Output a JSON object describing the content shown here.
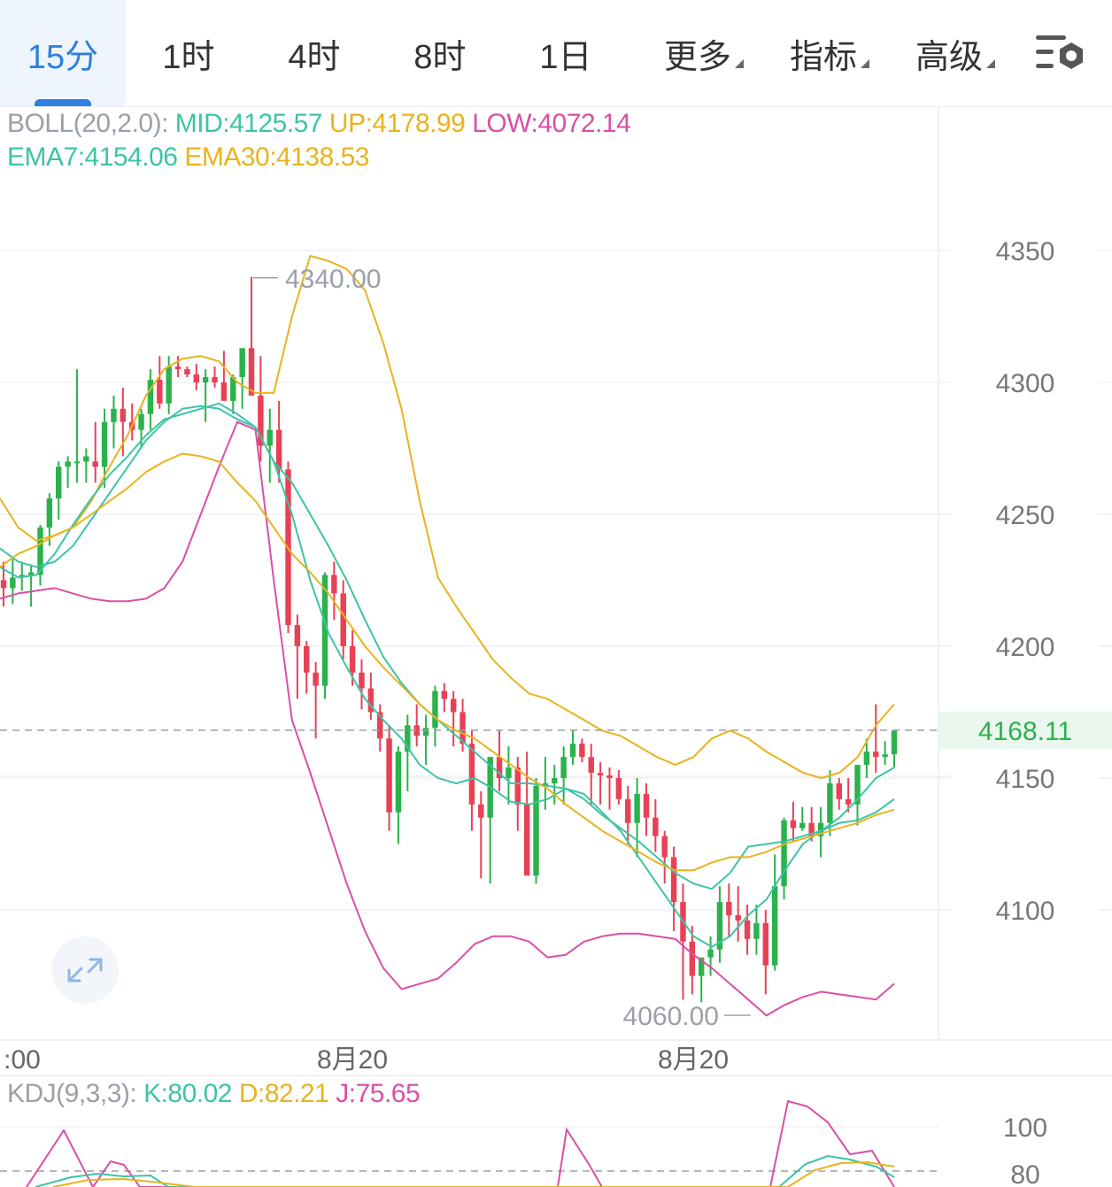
{
  "tabs": [
    {
      "label": "15分",
      "active": true
    },
    {
      "label": "1时"
    },
    {
      "label": "4时"
    },
    {
      "label": "8时"
    },
    {
      "label": "1日"
    },
    {
      "label": "更多",
      "dropdown": true
    },
    {
      "label": "指标",
      "dropdown": true
    },
    {
      "label": "高级",
      "dropdown": true
    }
  ],
  "icons": {
    "settings": "candlestick-settings-icon",
    "expand": "expand-arrows-icon"
  },
  "boll": {
    "prefix": "BOLL(20,2.0):",
    "mid": "MID:4125.57",
    "up": "UP:4178.99",
    "low": "LOW:4072.14"
  },
  "ema": {
    "ema7": "EMA7:4154.06",
    "ema30": "EMA30:4138.53"
  },
  "kdj": {
    "prefix": "KDJ(9,3,3):",
    "k": "K:80.02",
    "d": "D:82.21",
    "j": "J:75.65"
  },
  "colors": {
    "up": "#2bb24c",
    "down": "#e84155",
    "mid": "#3cc4a6",
    "upper": "#e8b31d",
    "lower": "#d94fa7",
    "ema7": "#3cc4a6",
    "ema30": "#e8b31d",
    "k": "#3cc4a6",
    "d": "#e8b31d",
    "j": "#d94fa7",
    "gray": "#9aa0a8",
    "current": "#2bb24c"
  },
  "chart_data": {
    "type": "candlestick",
    "ylim": [
      4060,
      4350
    ],
    "y_ticks": [
      "4350",
      "4300",
      "4250",
      "4200",
      "4150",
      "4100"
    ],
    "x_labels": [
      ":00",
      "8月20",
      "8月20"
    ],
    "current_price": "4168.11",
    "high_marker": "4340.00",
    "low_marker": "4060.00",
    "candles": [
      [
        4225,
        4232,
        4215,
        4222
      ],
      [
        4222,
        4234,
        4216,
        4226
      ],
      [
        4226,
        4232,
        4221,
        4227
      ],
      [
        4227,
        4231,
        4215,
        4228
      ],
      [
        4227,
        4246,
        4223,
        4245
      ],
      [
        4245,
        4258,
        4238,
        4256
      ],
      [
        4256,
        4270,
        4248,
        4268
      ],
      [
        4268,
        4272,
        4260,
        4270
      ],
      [
        4270,
        4305,
        4262,
        4270
      ],
      [
        4270,
        4275,
        4262,
        4272
      ],
      [
        4270,
        4285,
        4262,
        4268
      ],
      [
        4268,
        4290,
        4260,
        4285
      ],
      [
        4285,
        4295,
        4275,
        4290
      ],
      [
        4290,
        4298,
        4272,
        4285
      ],
      [
        4285,
        4292,
        4278,
        4282
      ],
      [
        4282,
        4290,
        4275,
        4288
      ],
      [
        4288,
        4305,
        4282,
        4301
      ],
      [
        4301,
        4310,
        4290,
        4292
      ],
      [
        4292,
        4310,
        4288,
        4306
      ],
      [
        4306,
        4310,
        4302,
        4305
      ],
      [
        4305,
        4306,
        4302,
        4303
      ],
      [
        4303,
        4307,
        4297,
        4300
      ],
      [
        4300,
        4305,
        4285,
        4302
      ],
      [
        4302,
        4306,
        4298,
        4300
      ],
      [
        4300,
        4312,
        4295,
        4293
      ],
      [
        4293,
        4303,
        4288,
        4302
      ],
      [
        4302,
        4312,
        4290,
        4313
      ],
      [
        4313,
        4340,
        4310,
        4295
      ],
      [
        4295,
        4310,
        4270,
        4276
      ],
      [
        4276,
        4290,
        4262,
        4282
      ],
      [
        4282,
        4293,
        4262,
        4267
      ],
      [
        4267,
        4270,
        4205,
        4208
      ],
      [
        4208,
        4212,
        4180,
        4200
      ],
      [
        4200,
        4202,
        4182,
        4190
      ],
      [
        4190,
        4194,
        4165,
        4185
      ],
      [
        4185,
        4228,
        4180,
        4227
      ],
      [
        4227,
        4232,
        4210,
        4220
      ],
      [
        4220,
        4225,
        4195,
        4200
      ],
      [
        4200,
        4206,
        4185,
        4190
      ],
      [
        4190,
        4195,
        4176,
        4184
      ],
      [
        4184,
        4190,
        4172,
        4175
      ],
      [
        4175,
        4178,
        4160,
        4165
      ],
      [
        4165,
        4170,
        4130,
        4137
      ],
      [
        4137,
        4162,
        4125,
        4160
      ],
      [
        4160,
        4174,
        4145,
        4170
      ],
      [
        4170,
        4178,
        4162,
        4166
      ],
      [
        4166,
        4174,
        4155,
        4169
      ],
      [
        4169,
        4185,
        4162,
        4183
      ],
      [
        4183,
        4186,
        4175,
        4180
      ],
      [
        4180,
        4183,
        4162,
        4175
      ],
      [
        4175,
        4180,
        4160,
        4163
      ],
      [
        4163,
        4168,
        4130,
        4140
      ],
      [
        4140,
        4145,
        4112,
        4135
      ],
      [
        4135,
        4158,
        4110,
        4158
      ],
      [
        4158,
        4168,
        4145,
        4150
      ],
      [
        4150,
        4162,
        4140,
        4154
      ],
      [
        4154,
        4158,
        4130,
        4140
      ],
      [
        4140,
        4160,
        4115,
        4113
      ],
      [
        4113,
        4150,
        4110,
        4147
      ],
      [
        4147,
        4158,
        4138,
        4148
      ],
      [
        4148,
        4155,
        4140,
        4150
      ],
      [
        4150,
        4162,
        4140,
        4158
      ],
      [
        4158,
        4168,
        4155,
        4163
      ],
      [
        4163,
        4165,
        4156,
        4158
      ],
      [
        4158,
        4163,
        4140,
        4152
      ],
      [
        4152,
        4156,
        4140,
        4151
      ],
      [
        4151,
        4154,
        4138,
        4150
      ],
      [
        4150,
        4153,
        4140,
        4142
      ],
      [
        4142,
        4147,
        4125,
        4133
      ],
      [
        4133,
        4150,
        4120,
        4144
      ],
      [
        4144,
        4148,
        4128,
        4135
      ],
      [
        4135,
        4142,
        4122,
        4128
      ],
      [
        4128,
        4130,
        4110,
        4120
      ],
      [
        4120,
        4124,
        4092,
        4103
      ],
      [
        4103,
        4110,
        4066,
        4088
      ],
      [
        4088,
        4094,
        4068,
        4075
      ],
      [
        4075,
        4080,
        4065,
        4082
      ],
      [
        4082,
        4090,
        4075,
        4085
      ],
      [
        4085,
        4109,
        4080,
        4103
      ],
      [
        4103,
        4110,
        4090,
        4098
      ],
      [
        4098,
        4109,
        4088,
        4096
      ],
      [
        4096,
        4102,
        4083,
        4089
      ],
      [
        4089,
        4102,
        4083,
        4095
      ],
      [
        4095,
        4100,
        4068,
        4079
      ],
      [
        4079,
        4121,
        4077,
        4109
      ],
      [
        4109,
        4135,
        4104,
        4134
      ],
      [
        4134,
        4141,
        4126,
        4131
      ],
      [
        4131,
        4139,
        4130,
        4133
      ],
      [
        4133,
        4139,
        4126,
        4128
      ],
      [
        4128,
        4139,
        4120,
        4133
      ],
      [
        4133,
        4153,
        4128,
        4148
      ],
      [
        4148,
        4150,
        4138,
        4142
      ],
      [
        4142,
        4150,
        4137,
        4140
      ],
      [
        4140,
        4155,
        4132,
        4155
      ],
      [
        4155,
        4165,
        4150,
        4160
      ],
      [
        4160,
        4178,
        4152,
        4158
      ],
      [
        4158,
        4164,
        4155,
        4159
      ],
      [
        4159,
        4168,
        4154,
        4168
      ]
    ],
    "series": [
      {
        "name": "BOLL UP",
        "values": [
          4256,
          4245,
          4240,
          4242,
          4245,
          4255,
          4268,
          4280,
          4295,
          4305,
          4309,
          4310,
          4308,
          4300,
          4296,
          4296,
          4325,
          4348,
          4346,
          4343,
          4335,
          4315,
          4290,
          4255,
          4226,
          4215,
          4205,
          4195,
          4188,
          4182,
          4180,
          4176,
          4172,
          4168,
          4166,
          4162,
          4158,
          4155,
          4158,
          4165,
          4168,
          4165,
          4160,
          4156,
          4152,
          4150,
          4152,
          4158,
          4170,
          4178
        ]
      },
      {
        "name": "BOLL MID",
        "values": [
          4237,
          4232,
          4230,
          4232,
          4238,
          4248,
          4258,
          4268,
          4278,
          4285,
          4290,
          4291,
          4290,
          4286,
          4283,
          4270,
          4262,
          4250,
          4238,
          4225,
          4210,
          4196,
          4186,
          4178,
          4172,
          4166,
          4160,
          4154,
          4148,
          4148,
          4147,
          4146,
          4142,
          4136,
          4131,
          4126,
          4120,
          4114,
          4110,
          4108,
          4114,
          4124,
          4125,
          4126,
          4128,
          4130,
          4133,
          4134,
          4137,
          4142
        ]
      },
      {
        "name": "BOLL LOW",
        "values": [
          4218,
          4220,
          4221,
          4222,
          4220,
          4218,
          4217,
          4217,
          4218,
          4222,
          4232,
          4250,
          4268,
          4285,
          4282,
          4225,
          4172,
          4152,
          4131,
          4110,
          4092,
          4078,
          4070,
          4072,
          4074,
          4080,
          4087,
          4090,
          4090,
          4088,
          4082,
          4083,
          4088,
          4090,
          4091,
          4091,
          4090,
          4089,
          4083,
          4078,
          4072,
          4066,
          4060,
          4064,
          4067,
          4069,
          4068,
          4067,
          4066,
          4072
        ]
      },
      {
        "name": "EMA7",
        "values": [
          4230,
          4226,
          4227,
          4235,
          4246,
          4256,
          4265,
          4272,
          4280,
          4286,
          4288,
          4290,
          4292,
          4288,
          4283,
          4270,
          4250,
          4225,
          4205,
          4192,
          4180,
          4172,
          4165,
          4155,
          4150,
          4148,
          4150,
          4146,
          4141,
          4140,
          4142,
          4146,
          4144,
          4137,
          4130,
          4120,
          4110,
          4100,
          4090,
          4086,
          4090,
          4098,
          4104,
          4115,
          4125,
          4130,
          4135,
          4142,
          4150,
          4154
        ]
      },
      {
        "name": "EMA30",
        "values": [
          4230,
          4235,
          4238,
          4242,
          4245,
          4250,
          4255,
          4260,
          4266,
          4270,
          4273,
          4272,
          4270,
          4262,
          4255,
          4245,
          4235,
          4228,
          4220,
          4210,
          4200,
          4192,
          4185,
          4178,
          4172,
          4168,
          4165,
          4160,
          4155,
          4150,
          4146,
          4140,
          4135,
          4130,
          4126,
          4122,
          4118,
          4115,
          4115,
          4118,
          4120,
          4120,
          4122,
          4125,
          4127,
          4129,
          4131,
          4133,
          4136,
          4138
        ]
      }
    ]
  }
}
